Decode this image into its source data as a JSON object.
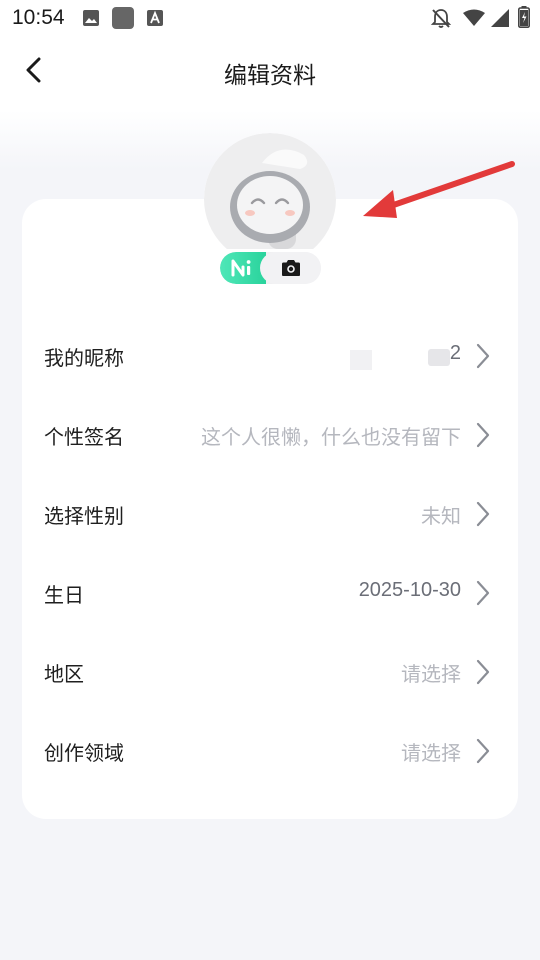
{
  "status_bar": {
    "time": "10:54",
    "left_icons": [
      "image-icon",
      "app-square-icon",
      "text-a-icon"
    ],
    "right_icons": [
      "bell-off-icon",
      "wifi-icon",
      "signal-icon",
      "battery-charging-icon"
    ]
  },
  "header": {
    "title": "编辑资料",
    "back_icon": "chevron-left-icon"
  },
  "avatar": {
    "toggle_ai_label": "AI",
    "toggle_camera_icon": "camera-icon"
  },
  "rows": [
    {
      "label": "我的昵称",
      "value": "2",
      "value_dark": true
    },
    {
      "label": "个性签名",
      "value": "这个人很懒，什么也没有留下",
      "value_dark": false
    },
    {
      "label": "选择性别",
      "value": "未知",
      "value_dark": false
    },
    {
      "label": "生日",
      "value": "2025-10-30",
      "value_dark": true
    },
    {
      "label": "地区",
      "value": "请选择",
      "value_dark": false
    },
    {
      "label": "创作领域",
      "value": "请选择",
      "value_dark": false
    }
  ],
  "colors": {
    "accent_green": "#2ad39c",
    "annotation_arrow": "#e23a3a",
    "placeholder_text": "#b5b7be",
    "background": "#f4f5f9"
  }
}
